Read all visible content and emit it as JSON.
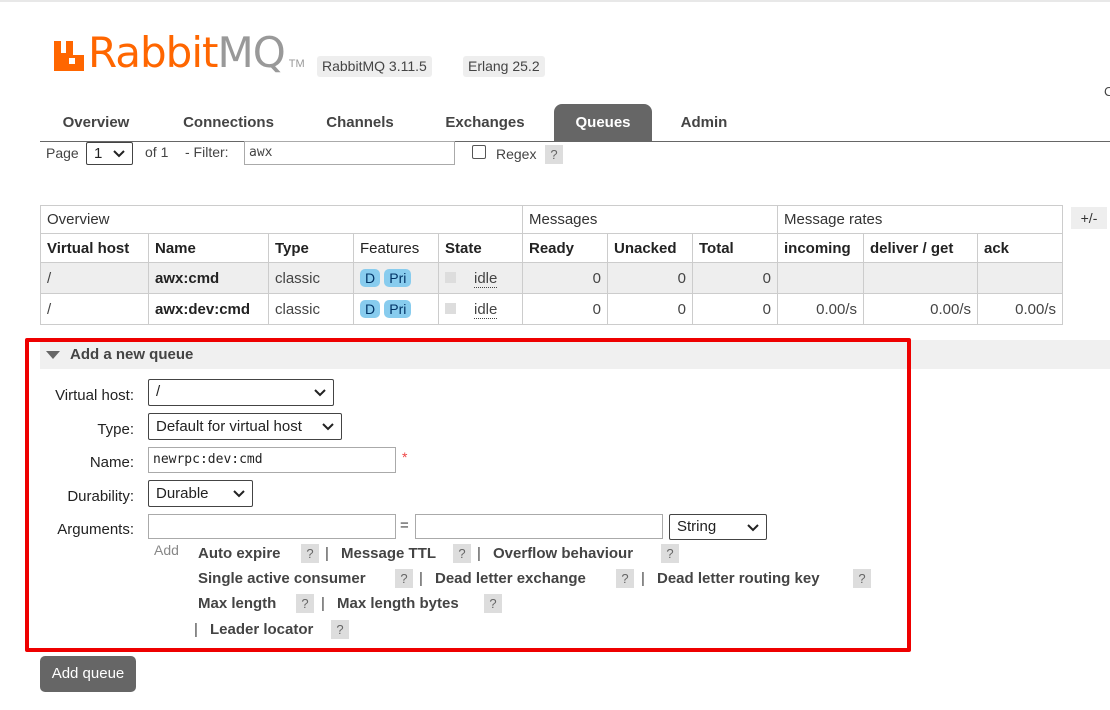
{
  "header": {
    "logo_rabbit": "Rabbit",
    "logo_mq": "MQ",
    "logo_tm": "TM",
    "version": "RabbitMQ 3.11.5",
    "erlang": "Erlang 25.2",
    "edge_char": "C"
  },
  "tabs": [
    {
      "label": "Overview"
    },
    {
      "label": "Connections"
    },
    {
      "label": "Channels"
    },
    {
      "label": "Exchanges"
    },
    {
      "label": "Queues"
    },
    {
      "label": "Admin"
    }
  ],
  "paging": {
    "page_label": "Page",
    "page_value": "1",
    "of_text": "of 1",
    "filter_label": "- Filter:",
    "filter_value": "awx",
    "regex_label": "Regex",
    "help": "?"
  },
  "table": {
    "plus_minus": "+/-",
    "groups": [
      "Overview",
      "Messages",
      "Message rates"
    ],
    "columns": [
      "Virtual host",
      "Name",
      "Type",
      "Features",
      "State",
      "Ready",
      "Unacked",
      "Total",
      "incoming",
      "deliver / get",
      "ack"
    ],
    "rows": [
      {
        "vhost": "/",
        "name": "awx:cmd",
        "type": "classic",
        "f1": "D",
        "f2": "Pri",
        "state": "idle",
        "ready": "0",
        "unacked": "0",
        "total": "0",
        "incoming": "",
        "deliver": "",
        "ack": ""
      },
      {
        "vhost": "/",
        "name": "awx:dev:cmd",
        "type": "classic",
        "f1": "D",
        "f2": "Pri",
        "state": "idle",
        "ready": "0",
        "unacked": "0",
        "total": "0",
        "incoming": "0.00/s",
        "deliver": "0.00/s",
        "ack": "0.00/s"
      }
    ]
  },
  "add_queue": {
    "title": "Add a new queue",
    "vhost_label": "Virtual host:",
    "vhost_value": "/",
    "type_label": "Type:",
    "type_value": "Default for virtual host",
    "name_label": "Name:",
    "name_value": "newrpc:dev:cmd",
    "required_mark": "*",
    "durability_label": "Durability:",
    "durability_value": "Durable",
    "arguments_label": "Arguments:",
    "equals": "=",
    "arg_type": "String",
    "add_word": "Add",
    "arg_links": [
      "Auto expire",
      "Message TTL",
      "Overflow behaviour",
      "Single active consumer",
      "Dead letter exchange",
      "Dead letter routing key",
      "Max length",
      "Max length bytes",
      "Leader locator"
    ],
    "separator": "|",
    "help": "?",
    "submit": "Add queue"
  },
  "colors": {
    "brand_orange": "#ff6600",
    "tab_active": "#666666",
    "highlight_border": "#e00000",
    "feature_badge": "#88ccee"
  }
}
